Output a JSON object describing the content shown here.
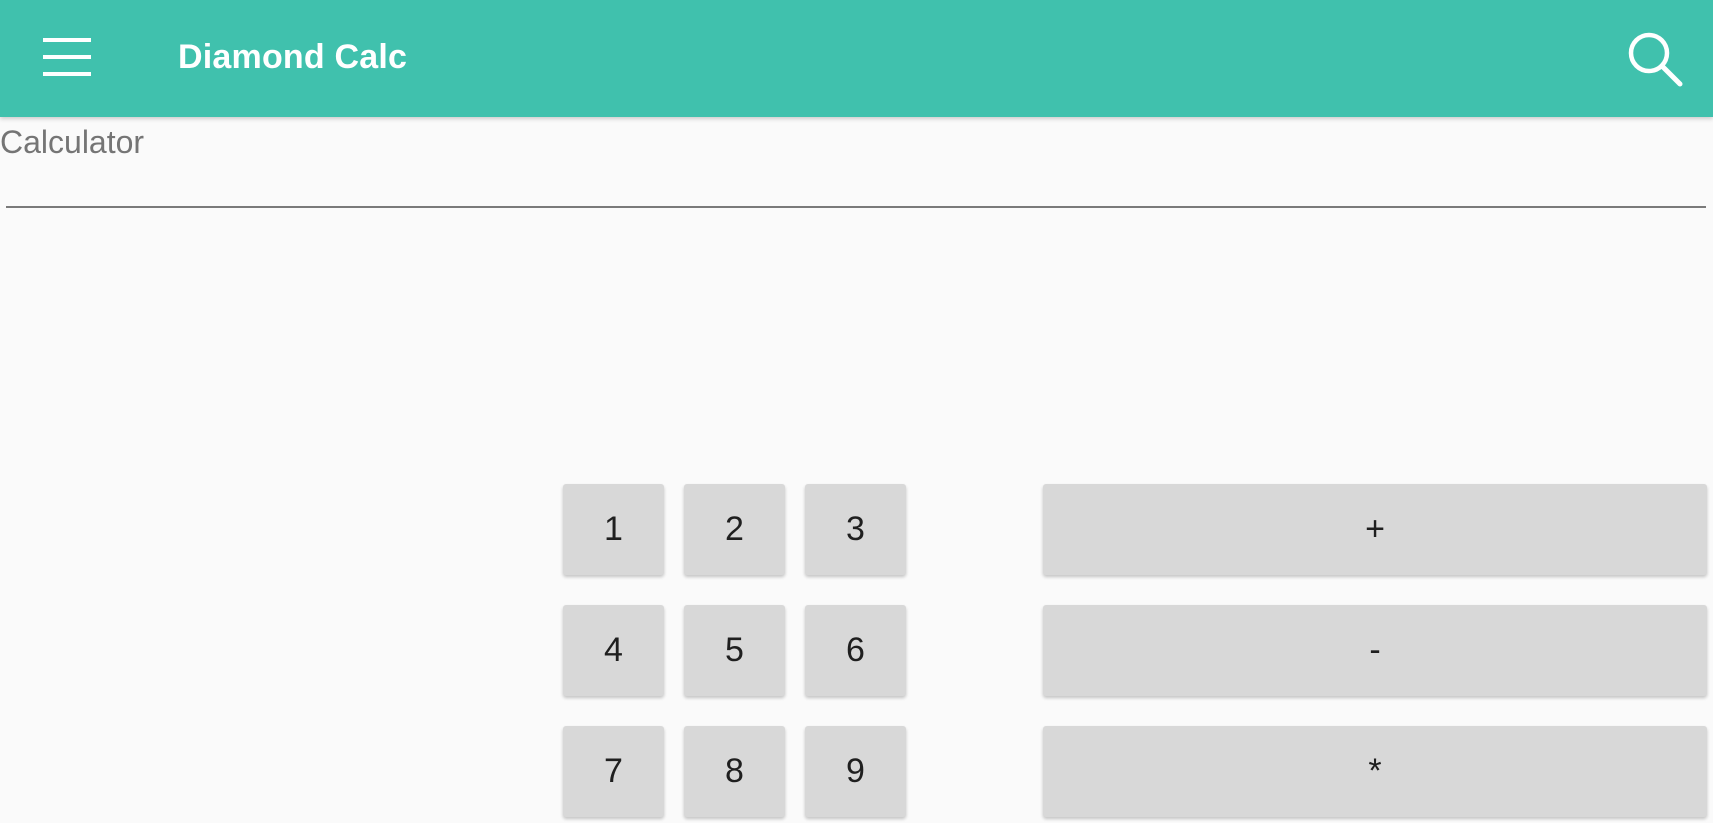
{
  "app_bar": {
    "title": "Diamond Calc",
    "menu_icon": "hamburger-menu-icon",
    "search_icon": "search-icon",
    "background_color": "#40c1ad"
  },
  "calculator_field": {
    "label": "Calculator",
    "value": ""
  },
  "keypad": {
    "digits": [
      "1",
      "2",
      "3",
      "4",
      "5",
      "6",
      "7",
      "8",
      "9"
    ],
    "operators": [
      "+",
      "-",
      "*"
    ]
  }
}
